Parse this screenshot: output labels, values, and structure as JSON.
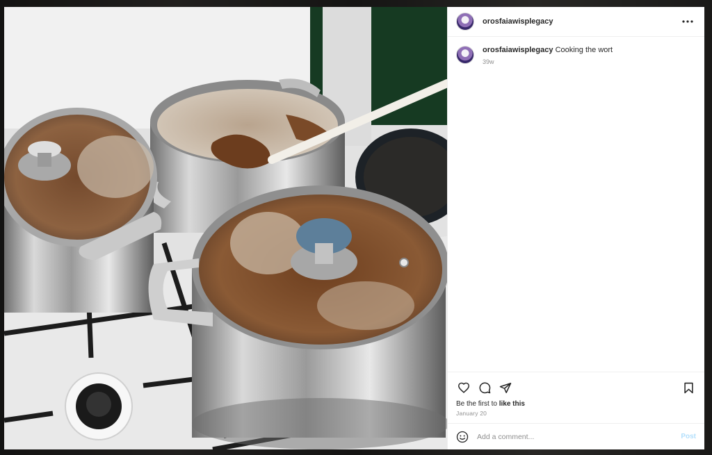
{
  "post": {
    "username": "orosfaiawisplegacy",
    "caption": "Cooking the wort",
    "age": "39w",
    "likes_prefix": "Be the first to ",
    "likes_link": "like this",
    "date": "January 20"
  },
  "comment_box": {
    "placeholder": "Add a comment...",
    "post_label": "Post"
  },
  "colors": {
    "post_button": "#b2dffc",
    "muted_text": "#8e8e8e"
  },
  "icons": [
    "more-icon",
    "heart-icon",
    "comment-icon",
    "share-icon",
    "bookmark-icon",
    "emoji-icon"
  ]
}
